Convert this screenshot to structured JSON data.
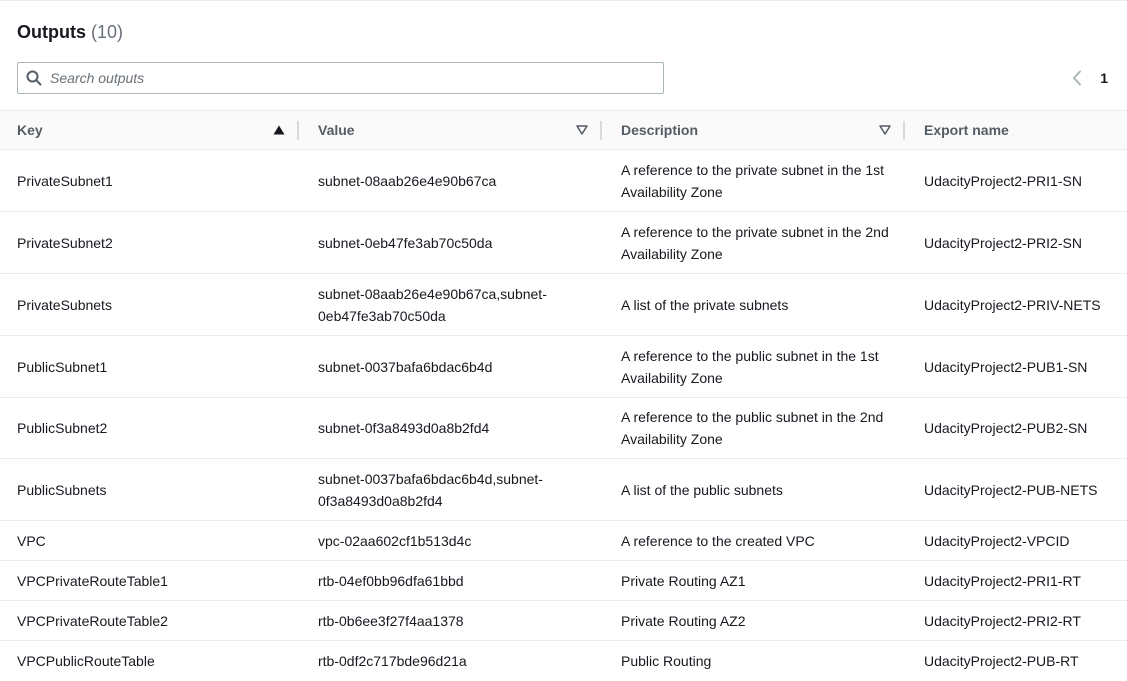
{
  "outputs": {
    "title": "Outputs",
    "count": "(10)"
  },
  "search": {
    "placeholder": "Search outputs",
    "value": ""
  },
  "pagination": {
    "current_page": "1"
  },
  "table": {
    "columns": [
      {
        "label": "Key",
        "sort_icon": "sort-ascending-filled-icon"
      },
      {
        "label": "Value",
        "sort_icon": "sort-unsorted-icon"
      },
      {
        "label": "Description",
        "sort_icon": "sort-unsorted-icon"
      },
      {
        "label": "Export name"
      }
    ],
    "rows": [
      {
        "key": "PrivateSubnet1",
        "value": "subnet-08aab26e4e90b67ca",
        "description": "A reference to the private subnet in the 1st Availability Zone",
        "export_name": "UdacityProject2-PRI1-SN"
      },
      {
        "key": "PrivateSubnet2",
        "value": "subnet-0eb47fe3ab70c50da",
        "description": "A reference to the private subnet in the 2nd Availability Zone",
        "export_name": "UdacityProject2-PRI2-SN"
      },
      {
        "key": "PrivateSubnets",
        "value": "subnet-08aab26e4e90b67ca,subnet-0eb47fe3ab70c50da",
        "description": "A list of the private subnets",
        "export_name": "UdacityProject2-PRIV-NETS"
      },
      {
        "key": "PublicSubnet1",
        "value": "subnet-0037bafa6bdac6b4d",
        "description": "A reference to the public subnet in the 1st Availability Zone",
        "export_name": "UdacityProject2-PUB1-SN"
      },
      {
        "key": "PublicSubnet2",
        "value": "subnet-0f3a8493d0a8b2fd4",
        "description": "A reference to the public subnet in the 2nd Availability Zone",
        "export_name": "UdacityProject2-PUB2-SN"
      },
      {
        "key": "PublicSubnets",
        "value": "subnet-0037bafa6bdac6b4d,subnet-0f3a8493d0a8b2fd4",
        "description": "A list of the public subnets",
        "export_name": "UdacityProject2-PUB-NETS"
      },
      {
        "key": "VPC",
        "value": "vpc-02aa602cf1b513d4c",
        "description": "A reference to the created VPC",
        "export_name": "UdacityProject2-VPCID"
      },
      {
        "key": "VPCPrivateRouteTable1",
        "value": "rtb-04ef0bb96dfa61bbd",
        "description": "Private Routing AZ1",
        "export_name": "UdacityProject2-PRI1-RT"
      },
      {
        "key": "VPCPrivateRouteTable2",
        "value": "rtb-0b6ee3f27f4aa1378",
        "description": "Private Routing AZ2",
        "export_name": "UdacityProject2-PRI2-RT"
      },
      {
        "key": "VPCPublicRouteTable",
        "value": "rtb-0df2c717bde96d21a",
        "description": "Public Routing",
        "export_name": "UdacityProject2-PUB-RT"
      }
    ]
  },
  "icons": {
    "search": "search-icon",
    "pager_prev": "chevron-left-icon"
  },
  "colors": {
    "text": "#16191f",
    "muted": "#687078",
    "header_text": "#545b64",
    "border": "#eaeded",
    "header_bg": "#fafafa"
  }
}
